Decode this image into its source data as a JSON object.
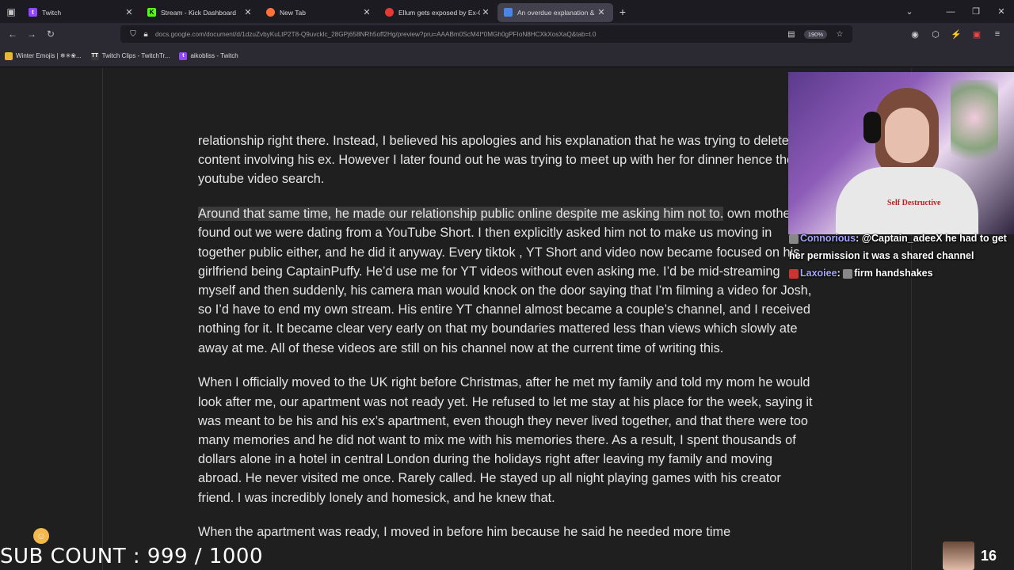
{
  "browser": {
    "tabs": [
      {
        "title": "Twitch",
        "active": false
      },
      {
        "title": "Stream - Kick Dashboard",
        "active": false
      },
      {
        "title": "New Tab",
        "active": false
      },
      {
        "title": "Ellum gets exposed by Ex-GF Ca",
        "active": false
      },
      {
        "title": "An overdue explanation & mov",
        "active": true
      }
    ],
    "url": "docs.google.com/document/d/1dzuZvbyKuLtP2T8-Q9uvcklc_28GPj658NRh5off2Hg/preview?pru=AAABm0ScM4I*0MGh0gPFIoN8HCXkXosXaQ&tab=t.0",
    "zoom": "190%",
    "bookmarks": [
      "Winter Emojis | ❄✳❀...",
      "Twitch Clips - TwitchTr...",
      "aikobliss - Twitch"
    ]
  },
  "document": {
    "paragraphs": [
      "relationship right there. Instead, I believed his apologies and his explanation that he was trying to delete old content involving his ex. However I later found out he was trying to meet up with her for dinner hence the youtube video search.",
      "Around that same time, he made our relationship public online despite me asking him not to.",
      "own mother found out we were dating from a YouTube Short. I then explicitly asked him not to make us moving in together public either, and he did it anyway. Every tiktok , YT Short and video now became focused on his girlfriend being CaptainPuffy. He’d use me for YT videos without even asking me. I’d be mid-streaming myself and then suddenly, his camera man would knock on the door saying that I’m filming a video for Josh, so I’d have to end my own stream. His entire YT channel almost became a couple’s channel, and I received nothing for it. It became clear very early on that my boundaries mattered less than views which slowly ate away at me. All of these videos are still on his channel now at the current time of writing this.",
      "When I officially moved to the UK right before Christmas, after he met my family and told my mom he would look after me, our apartment was not ready yet. He refused to let me stay at his place for the week, saying it was meant to be his and his ex’s apartment, even though they never lived together, and that there were too many memories and he did not want to mix me with his memories there. As a result, I spent thousands of dollars alone in a hotel in central London during the holidays right after leaving my family and moving abroad. He never visited me once. Rarely called. He stayed up all night playing games with his creator friend. I was incredibly lonely and homesick, and he knew that.",
      "When the apartment was ready, I moved in before him because he said he needed more time"
    ]
  },
  "overlay": {
    "webcam_shirt_text": "Self Destructive",
    "chat": [
      {
        "user": "Connorious",
        "text": "@Captain_adeeX he had to get her permission it was a shared channel"
      },
      {
        "user": "Laxoiee",
        "text": "firm handshakes"
      }
    ],
    "sub_count": "SUB COUNT : 999 / 1000",
    "viewer_count": "16"
  }
}
